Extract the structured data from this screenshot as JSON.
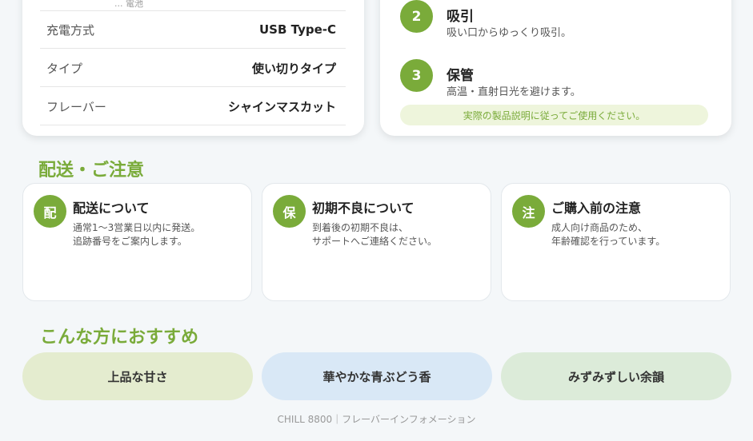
{
  "spec": {
    "cut_text": "... 電池",
    "rows": [
      {
        "label": "充電方式",
        "value": "USB Type-C"
      },
      {
        "label": "タイプ",
        "value": "使い切りタイプ"
      },
      {
        "label": "フレーバー",
        "value": "シャインマスカット"
      }
    ]
  },
  "usage": {
    "steps": [
      {
        "num": "2",
        "title": "吸引",
        "desc": "吸い口からゆっくり吸引。"
      },
      {
        "num": "3",
        "title": "保管",
        "desc": "高温・直射日光を避けます。"
      }
    ],
    "note": "実際の製品説明に従ってご使用ください。"
  },
  "shipping": {
    "title": "配送・ご注意",
    "cards": [
      {
        "icon": "配",
        "title": "配送について",
        "lines": [
          "通常1〜3営業日以内に発送。",
          "追跡番号をご案内します。"
        ]
      },
      {
        "icon": "保",
        "title": "初期不良について",
        "lines": [
          "到着後の初期不良は、",
          "サポートへご連絡ください。"
        ]
      },
      {
        "icon": "注",
        "title": "ご購入前の注意",
        "lines": [
          "成人向け商品のため、",
          "年齢確認を行っています。"
        ]
      }
    ]
  },
  "recommend": {
    "title": "こんな方におすすめ",
    "pills": [
      {
        "label": "上品な甘さ",
        "color": "#e4eccf"
      },
      {
        "label": "華やかな青ぶどう香",
        "color": "#d9e8f6"
      },
      {
        "label": "みずみずしい余韻",
        "color": "#dcebd9"
      }
    ]
  },
  "footer": {
    "text": "CHILL 8800｜フレーバーインフォメーション"
  },
  "colors": {
    "accent": "#7aab3a"
  }
}
